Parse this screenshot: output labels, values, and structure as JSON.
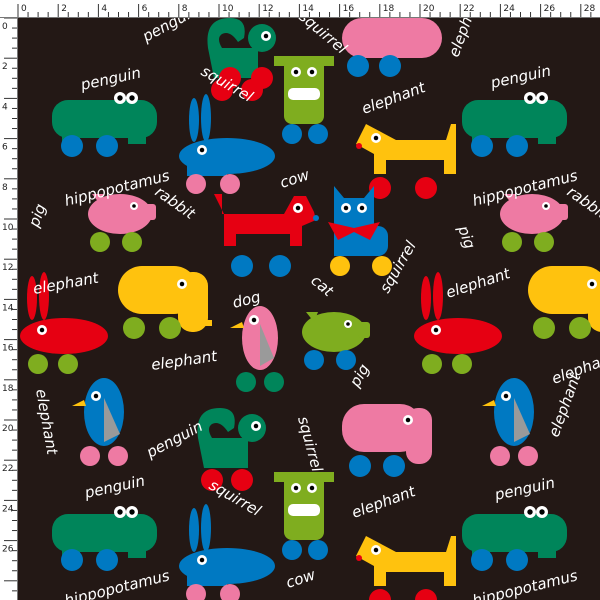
{
  "ruler": {
    "unit": "cm",
    "top_ticks": [
      "0",
      "2",
      "4",
      "6",
      "8",
      "10",
      "12",
      "14",
      "16",
      "18",
      "20",
      "22",
      "24",
      "26",
      "28"
    ],
    "left_ticks": [
      "0",
      "2",
      "4",
      "6",
      "8",
      "10",
      "12",
      "14",
      "16",
      "18",
      "20",
      "22",
      "24",
      "26"
    ]
  },
  "fabric": {
    "background": "#231815",
    "labels": {
      "penguin": "penguin",
      "hippopotamus": "hippopotamus",
      "rabbit": "rabbit",
      "cow": "cow",
      "squirrel": "squirrel",
      "elephant": "elephant",
      "pig": "pig",
      "dog": "dog",
      "cat": "cat"
    },
    "colors": {
      "yellow": "#ffc20e",
      "green": "#00855a",
      "blue": "#0079c2",
      "red": "#e60012",
      "pink": "#ee7aa3",
      "lime": "#7fad1f",
      "grey": "#9a9a9a",
      "white": "#ffffff"
    }
  }
}
